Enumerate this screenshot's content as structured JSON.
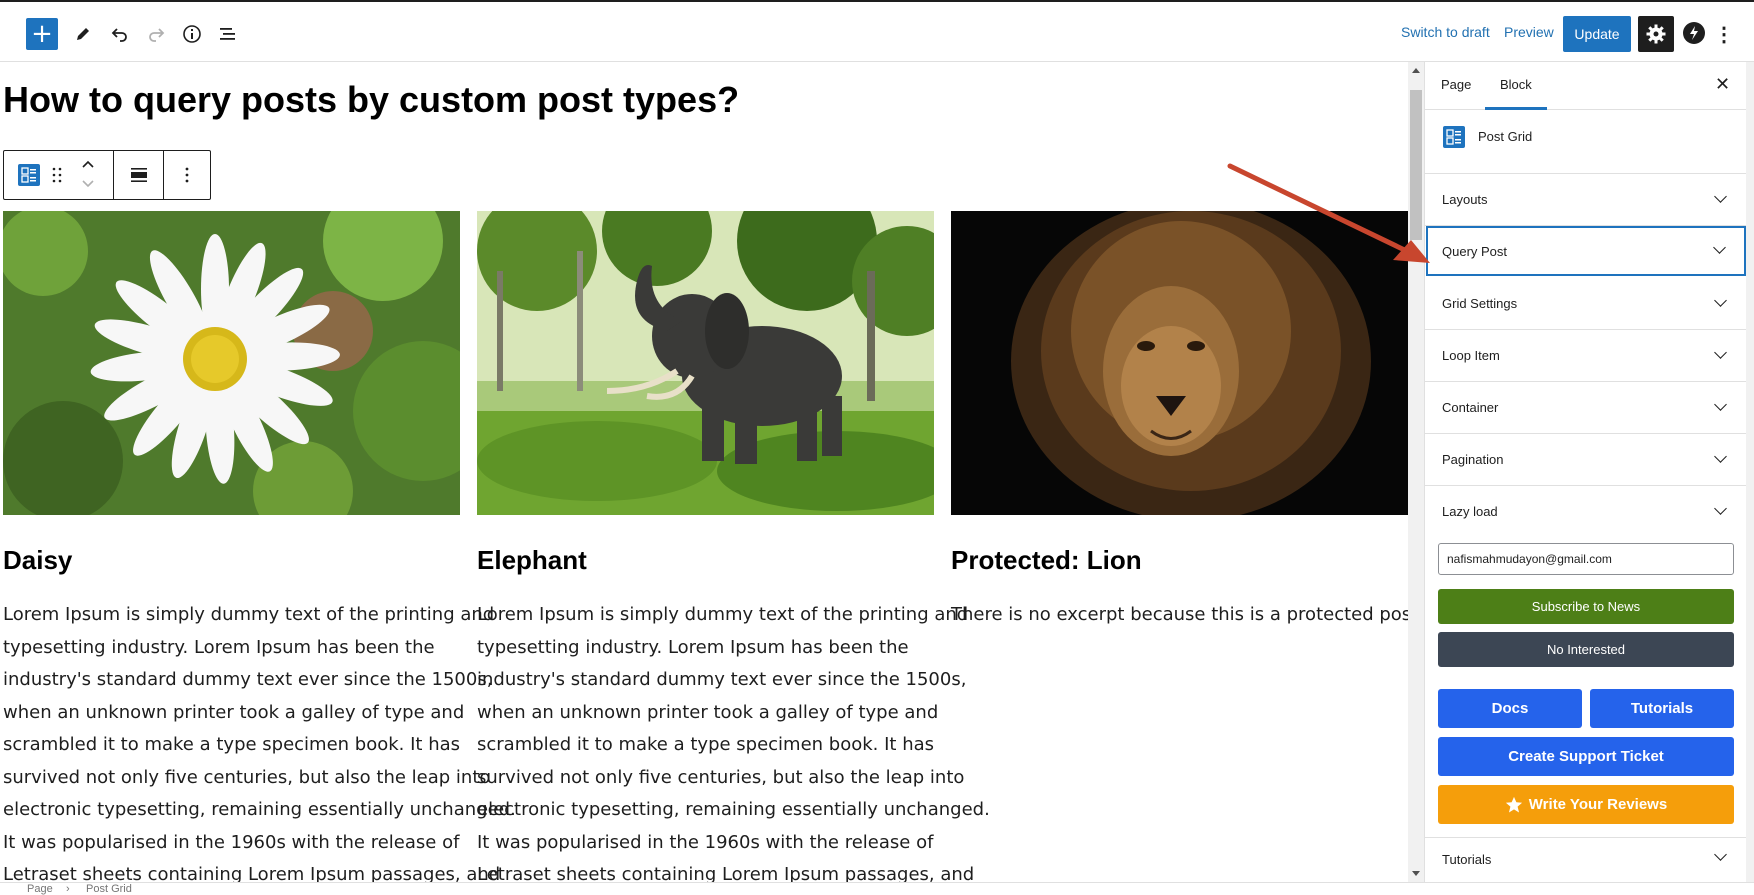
{
  "toolbar": {
    "switch_to_draft": "Switch to draft",
    "preview": "Preview",
    "update": "Update",
    "inserter_symbol": "+",
    "more_symbol": "⋮"
  },
  "post": {
    "title": "How to query posts by custom post types?"
  },
  "grid": [
    {
      "title": "Daisy",
      "image": "daisy-image",
      "excerpt": [
        "Lorem Ipsum is simply dummy text of the printing and",
        "typesetting industry. Lorem Ipsum has been the",
        "industry's standard dummy text ever since the 1500s,",
        "when an unknown printer took a galley of type and",
        "scrambled it to make a type specimen book. It has",
        "survived not only five centuries, but also the leap into",
        "electronic typesetting, remaining essentially unchanged.",
        "It was popularised in the 1960s with the release of",
        "Letraset sheets containing Lorem Ipsum passages, and"
      ]
    },
    {
      "title": "Elephant",
      "image": "elephant-image",
      "excerpt": [
        "Lorem Ipsum is simply dummy text of the printing and",
        "typesetting industry. Lorem Ipsum has been the",
        "industry's standard dummy text ever since the 1500s,",
        "when an unknown printer took a galley of type and",
        "scrambled it to make a type specimen book. It has",
        "survived not only five centuries, but also the leap into",
        "electronic typesetting, remaining essentially unchanged.",
        "It was popularised in the 1960s with the release of",
        "Letraset sheets containing Lorem Ipsum passages, and"
      ]
    },
    {
      "title": "Protected: Lion",
      "image": "lion-image",
      "excerpt": [
        "There is no excerpt because this is a protected post."
      ]
    }
  ],
  "sidebar": {
    "tabs": [
      {
        "label": "Page"
      },
      {
        "label": "Block"
      }
    ],
    "close_symbol": "✕",
    "block_name": "Post Grid",
    "panels": [
      {
        "label": "Layouts"
      },
      {
        "label": "Query Post"
      },
      {
        "label": "Grid Settings"
      },
      {
        "label": "Loop Item"
      },
      {
        "label": "Container"
      },
      {
        "label": "Pagination"
      },
      {
        "label": "Lazy load"
      }
    ],
    "email_value": "nafismahmudayon@gmail.com",
    "subscribe_label": "Subscribe to News",
    "no_interested_label": "No Interested",
    "docs_label": "Docs",
    "tutorials_label": "Tutorials",
    "support_label": "Create Support Ticket",
    "reviews_label": "Write Your Reviews",
    "bottom_panel": "Tutorials"
  },
  "breadcrumb": {
    "items": [
      "Page",
      "Post Grid"
    ],
    "separator": "›"
  },
  "colors": {
    "accent": "#1e73be",
    "subscribe_green": "#4d7f17",
    "no_interested_gray": "#3c4654",
    "docs_blue": "#2563eb",
    "reviews_orange": "#f59e0b",
    "annotation_red": "#c8462e"
  }
}
